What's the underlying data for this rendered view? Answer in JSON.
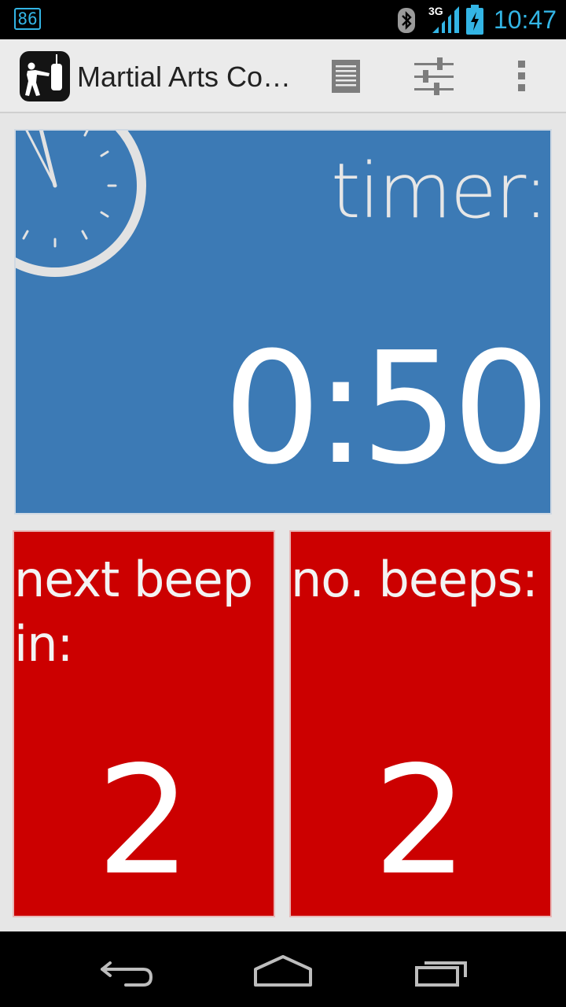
{
  "status_bar": {
    "notification": "86",
    "network": "3G",
    "time": "10:47",
    "icons": [
      "bluetooth-icon",
      "signal-icon",
      "battery-charging-icon"
    ]
  },
  "action_bar": {
    "title": "Martial Arts Co…",
    "actions": [
      "list-icon",
      "sliders-icon",
      "overflow-menu-icon"
    ]
  },
  "timer": {
    "label": "timer:",
    "value": "0:50"
  },
  "next_beep": {
    "label": "next beep in:",
    "value": "2"
  },
  "beep_count": {
    "label": "no. beeps:",
    "value": "2"
  },
  "nav_bar": {
    "buttons": [
      "back-icon",
      "home-icon",
      "recents-icon"
    ]
  },
  "colors": {
    "timer_tile": "#3c7ab5",
    "beep_tiles": "#cc0000",
    "accent": "#33b5e5"
  }
}
